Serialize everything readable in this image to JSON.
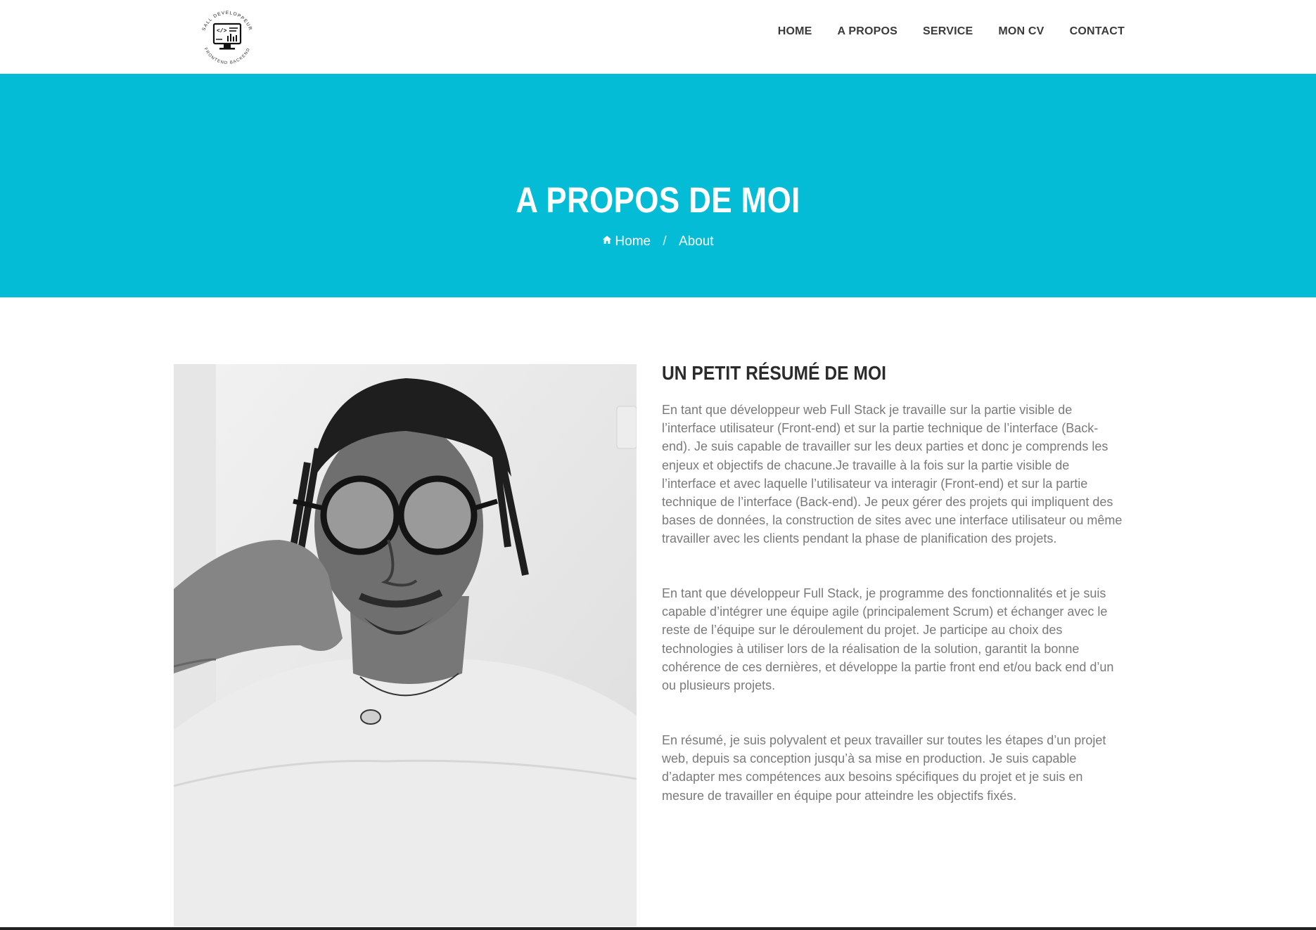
{
  "nav": {
    "items": [
      {
        "label": "HOME"
      },
      {
        "label": "A PROPOS"
      },
      {
        "label": "SERVICE"
      },
      {
        "label": "MON CV"
      },
      {
        "label": "CONTACT"
      }
    ]
  },
  "logo": {
    "top_text": "SALL DEVELOPPEUR",
    "bottom_text": "FRONTEND BACKEND"
  },
  "hero": {
    "title": "A PROPOS DE MOI",
    "breadcrumb": {
      "home": "Home",
      "separator": "/",
      "current": "About"
    },
    "background_color": "#05bcd6"
  },
  "about": {
    "title": "UN PETIT RÉSUMÉ DE MOI",
    "paragraphs": [
      "En tant que développeur web Full Stack je travaille sur la partie visible de l’interface utilisateur (Front-end) et sur la partie technique de l’interface (Back-end). Je suis capable de travailler sur les deux parties et donc je comprends les enjeux et objectifs de chacune.Je travaille à la fois sur la partie visible de l’interface et avec laquelle l’utilisateur va interagir (Front-end) et sur la partie technique de l’interface (Back-end). Je peux gérer des projets qui impliquent des bases de données, la construction de sites avec une interface utilisateur ou même travailler avec les clients pendant la phase de planification des projets.",
      "En tant que développeur Full Stack, je programme des fonctionnalités et je suis capable d’intégrer une équipe agile (principalement Scrum) et échanger avec le reste de l’équipe sur le déroulement du projet. Je participe au choix des technologies à utiliser lors de la réalisation de la solution, garantit la bonne cohérence de ces dernières, et développe la partie front end et/ou back end d’un ou plusieurs projets.",
      "En résumé, je suis polyvalent et peux travailler sur toutes les étapes d’un projet web, depuis sa conception jusqu’à sa mise en production. Je suis capable d’adapter mes compétences aux besoins spécifiques du projet et je suis en mesure de travailler en équipe pour atteindre les objectifs fixés."
    ]
  }
}
